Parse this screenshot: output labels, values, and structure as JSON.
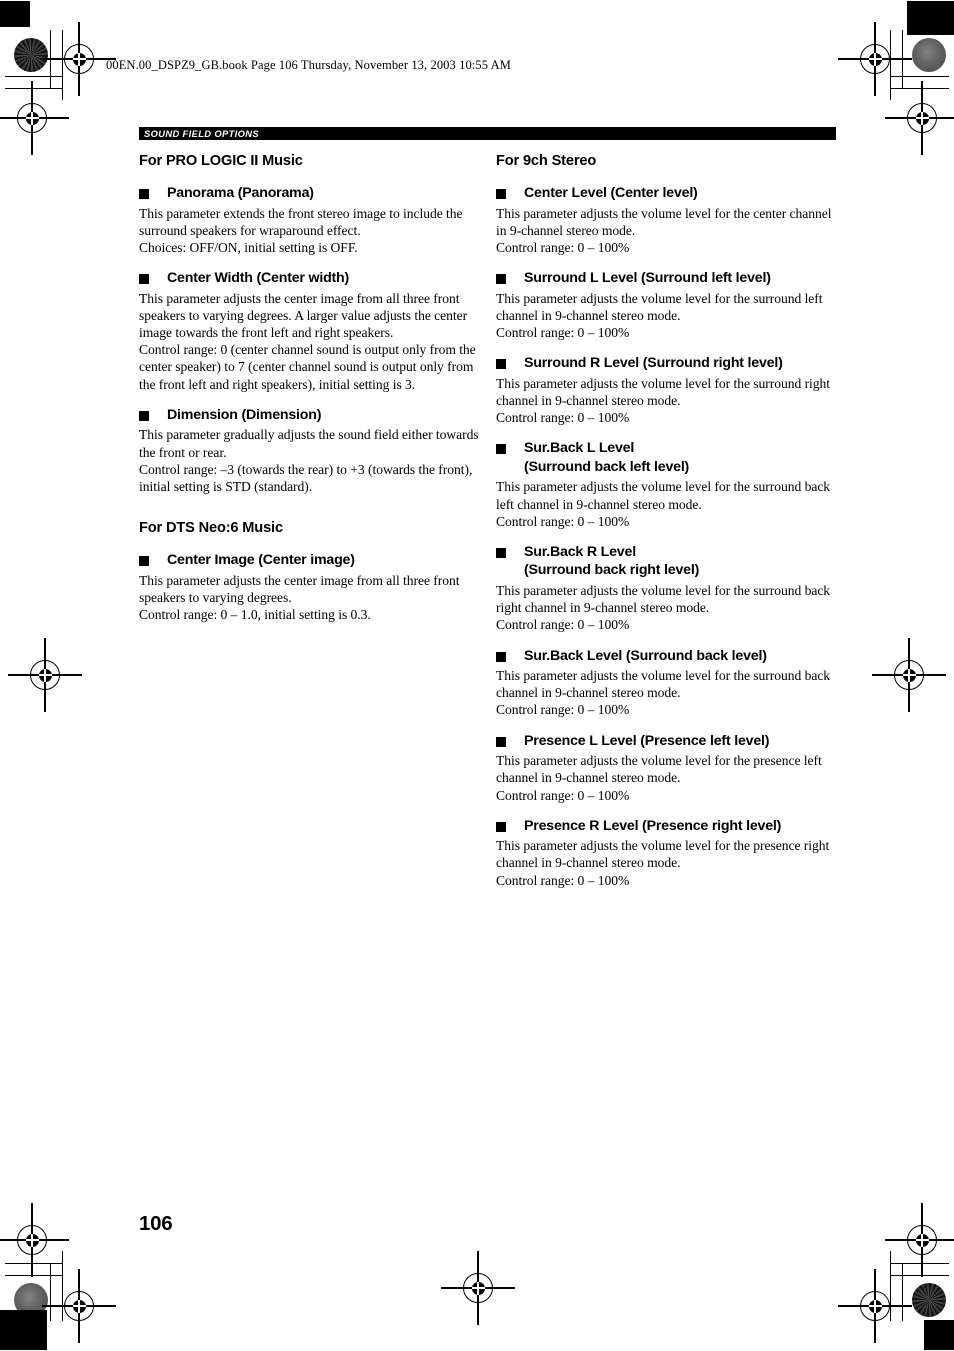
{
  "print_marks": {
    "file_header": "00EN.00_DSPZ9_GB.book  Page 106  Thursday, November 13, 2003  10:55 AM"
  },
  "section_bar": {
    "label": "SOUND FIELD OPTIONS"
  },
  "folio": {
    "page_number": "106"
  },
  "left_column": {
    "groups": [
      {
        "title": "For PRO LOGIC II Music",
        "entries": [
          {
            "heading": "Panorama (Panorama)",
            "heading_line2": "",
            "lines": [
              "This parameter extends the front stereo image to include the surround speakers for wraparound effect.",
              "Choices: OFF/ON, initial setting is OFF."
            ]
          },
          {
            "heading": "Center Width (Center width)",
            "heading_line2": "",
            "lines": [
              "This parameter adjusts the center image from all three front speakers to varying degrees. A larger value adjusts the center image towards the front left and right speakers.",
              "Control range: 0 (center channel sound is output only from the center speaker) to 7 (center channel sound is output only from the front left and right speakers), initial setting is 3."
            ]
          },
          {
            "heading": "Dimension (Dimension)",
            "heading_line2": "",
            "lines": [
              "This parameter gradually adjusts the sound field either towards the front or rear.",
              "Control range: –3 (towards the rear) to +3 (towards the front), initial setting is STD (standard)."
            ]
          }
        ]
      },
      {
        "title": "For DTS Neo:6 Music",
        "entries": [
          {
            "heading": "Center Image (Center image)",
            "heading_line2": "",
            "lines": [
              "This parameter adjusts the center image from all three front speakers to varying degrees.",
              "Control range: 0 – 1.0, initial setting is 0.3."
            ]
          }
        ]
      }
    ]
  },
  "right_column": {
    "groups": [
      {
        "title": "For 9ch Stereo",
        "entries": [
          {
            "heading": "Center Level (Center level)",
            "heading_line2": "",
            "lines": [
              "This parameter adjusts the volume level for the center channel in 9-channel stereo mode.",
              "Control range: 0 – 100%"
            ]
          },
          {
            "heading": "Surround L Level (Surround left level)",
            "heading_line2": "",
            "lines": [
              "This parameter adjusts the volume level for the surround left channel in 9-channel stereo mode.",
              "Control range: 0 – 100%"
            ]
          },
          {
            "heading": "Surround R Level (Surround right level)",
            "heading_line2": "",
            "lines": [
              "This parameter adjusts the volume level for the surround right channel in 9-channel stereo mode.",
              "Control range: 0 – 100%"
            ]
          },
          {
            "heading": "Sur.Back L Level",
            "heading_line2": "(Surround back left level)",
            "lines": [
              "This parameter adjusts the volume level for the surround back left channel in 9-channel stereo mode.",
              "Control range: 0 – 100%"
            ]
          },
          {
            "heading": "Sur.Back R Level",
            "heading_line2": "(Surround back right level)",
            "lines": [
              "This parameter adjusts the volume level for the surround back right channel in 9-channel stereo mode.",
              "Control range: 0 – 100%"
            ]
          },
          {
            "heading": "Sur.Back Level (Surround back level)",
            "heading_line2": "",
            "lines": [
              "This parameter adjusts the volume level for the surround back channel in 9-channel stereo mode.",
              "Control range: 0 – 100%"
            ]
          },
          {
            "heading": "Presence L Level (Presence left level)",
            "heading_line2": "",
            "lines": [
              "This parameter adjusts the volume level for the presence left channel in 9-channel stereo mode.",
              "Control range: 0 – 100%"
            ]
          },
          {
            "heading": "Presence R Level (Presence right level)",
            "heading_line2": "",
            "lines": [
              "This parameter adjusts the volume level for the presence right channel in 9-channel stereo mode.",
              "Control range: 0 – 100%"
            ]
          }
        ]
      }
    ]
  }
}
